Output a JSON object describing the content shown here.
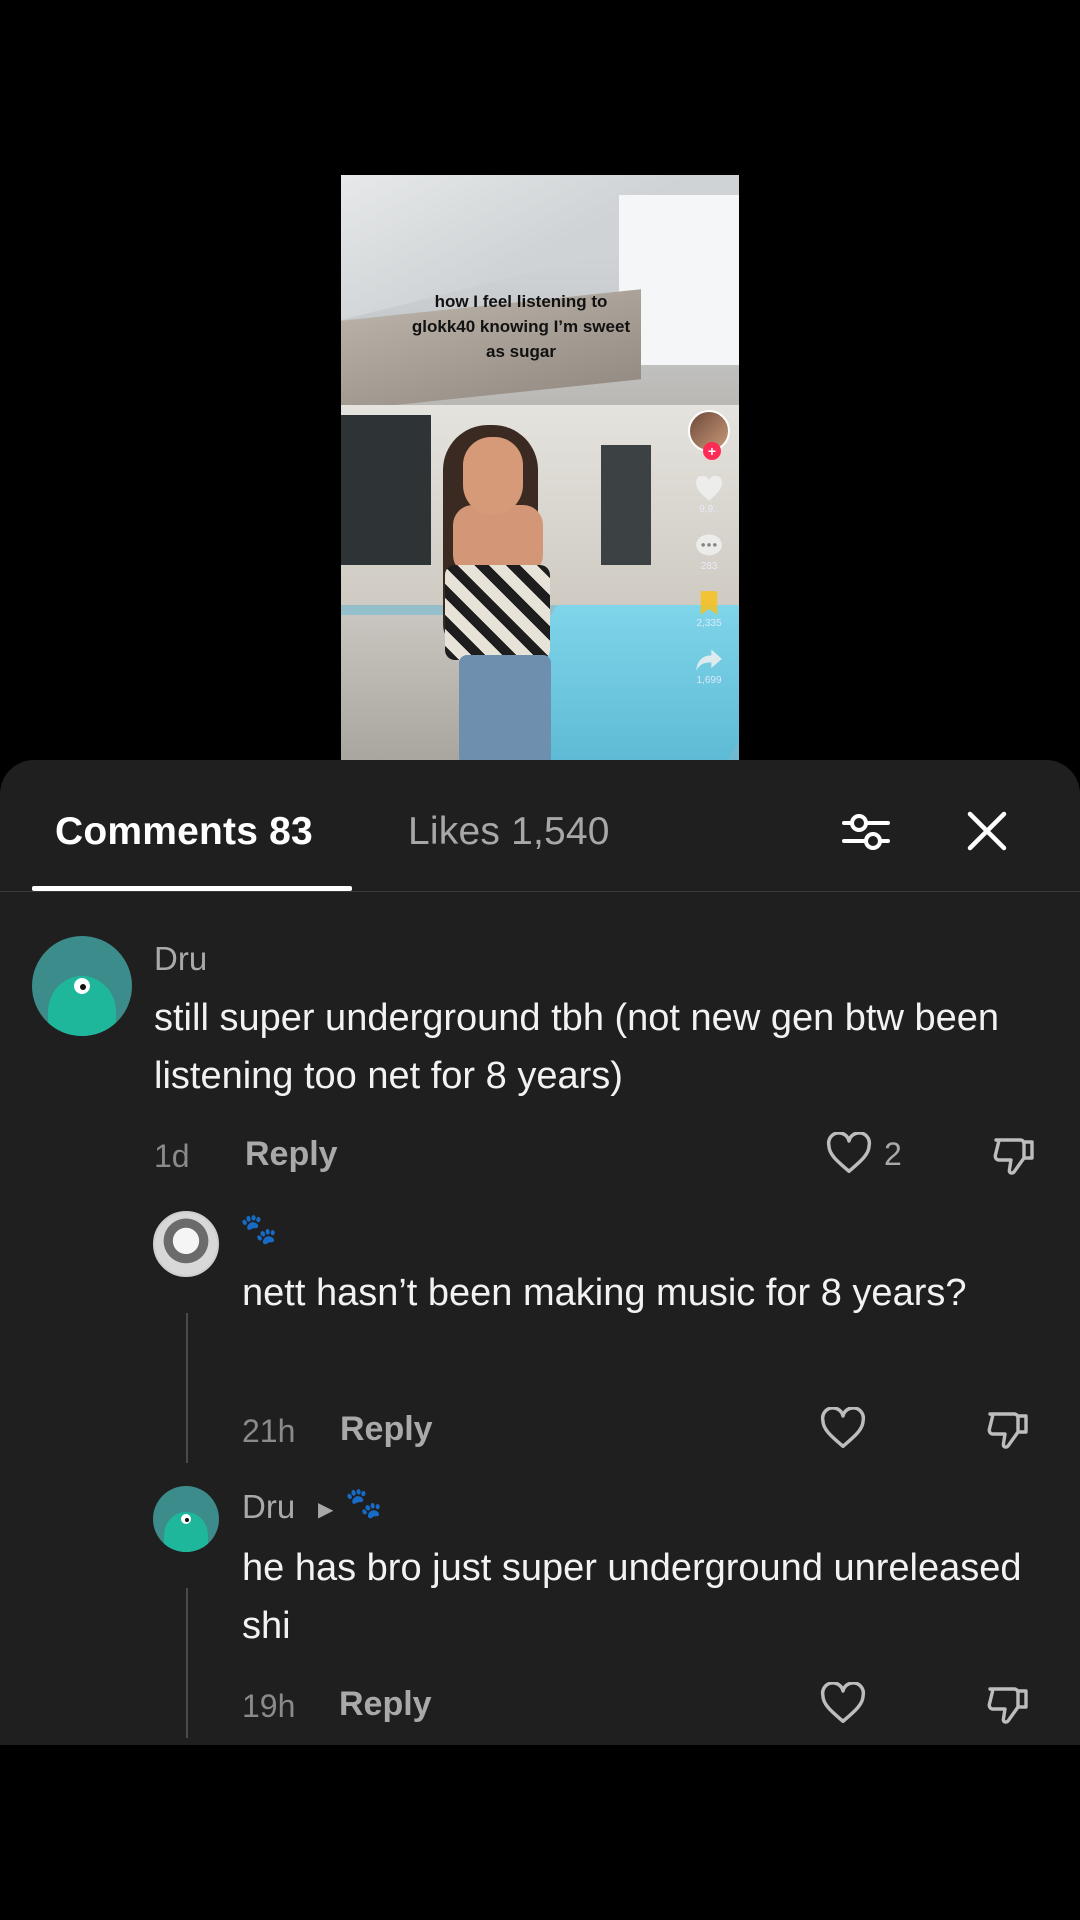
{
  "video": {
    "caption": "how I feel listening to glokk40 knowing I’m sweet as sugar",
    "likes": "9,9..",
    "comments": "283",
    "saves": "2,335",
    "shares": "1,699"
  },
  "sheet": {
    "tabs": [
      {
        "label": "Comments 83",
        "active": true
      },
      {
        "label": "Likes 1,540",
        "active": false
      }
    ]
  },
  "comments": [
    {
      "username": "Dru",
      "text": "still super underground tbh (not new gen btw been listening too net for 8 years)",
      "time": "1d",
      "reply_label": "Reply",
      "like_count": "2"
    },
    {
      "username": "🐾",
      "text": "nett hasn’t been making music for 8 years?",
      "time": "21h",
      "reply_label": "Reply"
    },
    {
      "username": "Dru",
      "reply_to": "🐾",
      "text": "he has bro just super underground unreleased shi",
      "time": "19h",
      "reply_label": "Reply"
    }
  ],
  "colors": {
    "sheet_bg": "#1f1f1f",
    "accent_red": "#fe2c55",
    "muted_text": "#a9a9a9"
  }
}
